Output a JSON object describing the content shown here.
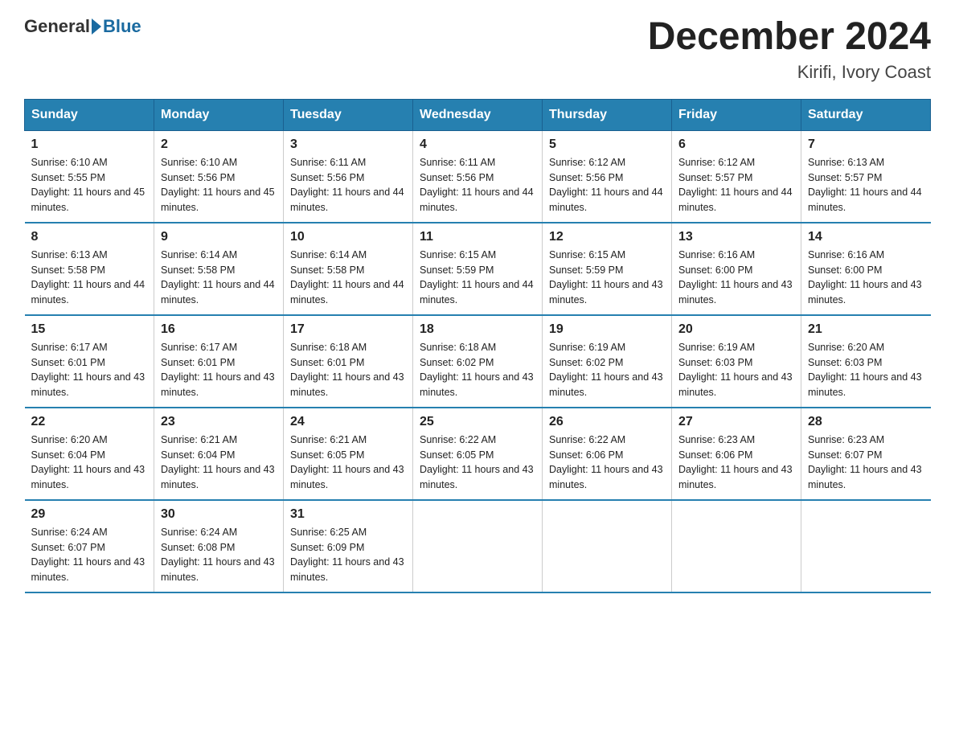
{
  "header": {
    "logo_general": "General",
    "logo_blue": "Blue",
    "month_title": "December 2024",
    "location": "Kirifi, Ivory Coast"
  },
  "weekdays": [
    "Sunday",
    "Monday",
    "Tuesday",
    "Wednesday",
    "Thursday",
    "Friday",
    "Saturday"
  ],
  "weeks": [
    [
      {
        "day": "1",
        "sunrise": "6:10 AM",
        "sunset": "5:55 PM",
        "daylight": "11 hours and 45 minutes."
      },
      {
        "day": "2",
        "sunrise": "6:10 AM",
        "sunset": "5:56 PM",
        "daylight": "11 hours and 45 minutes."
      },
      {
        "day": "3",
        "sunrise": "6:11 AM",
        "sunset": "5:56 PM",
        "daylight": "11 hours and 44 minutes."
      },
      {
        "day": "4",
        "sunrise": "6:11 AM",
        "sunset": "5:56 PM",
        "daylight": "11 hours and 44 minutes."
      },
      {
        "day": "5",
        "sunrise": "6:12 AM",
        "sunset": "5:56 PM",
        "daylight": "11 hours and 44 minutes."
      },
      {
        "day": "6",
        "sunrise": "6:12 AM",
        "sunset": "5:57 PM",
        "daylight": "11 hours and 44 minutes."
      },
      {
        "day": "7",
        "sunrise": "6:13 AM",
        "sunset": "5:57 PM",
        "daylight": "11 hours and 44 minutes."
      }
    ],
    [
      {
        "day": "8",
        "sunrise": "6:13 AM",
        "sunset": "5:58 PM",
        "daylight": "11 hours and 44 minutes."
      },
      {
        "day": "9",
        "sunrise": "6:14 AM",
        "sunset": "5:58 PM",
        "daylight": "11 hours and 44 minutes."
      },
      {
        "day": "10",
        "sunrise": "6:14 AM",
        "sunset": "5:58 PM",
        "daylight": "11 hours and 44 minutes."
      },
      {
        "day": "11",
        "sunrise": "6:15 AM",
        "sunset": "5:59 PM",
        "daylight": "11 hours and 44 minutes."
      },
      {
        "day": "12",
        "sunrise": "6:15 AM",
        "sunset": "5:59 PM",
        "daylight": "11 hours and 43 minutes."
      },
      {
        "day": "13",
        "sunrise": "6:16 AM",
        "sunset": "6:00 PM",
        "daylight": "11 hours and 43 minutes."
      },
      {
        "day": "14",
        "sunrise": "6:16 AM",
        "sunset": "6:00 PM",
        "daylight": "11 hours and 43 minutes."
      }
    ],
    [
      {
        "day": "15",
        "sunrise": "6:17 AM",
        "sunset": "6:01 PM",
        "daylight": "11 hours and 43 minutes."
      },
      {
        "day": "16",
        "sunrise": "6:17 AM",
        "sunset": "6:01 PM",
        "daylight": "11 hours and 43 minutes."
      },
      {
        "day": "17",
        "sunrise": "6:18 AM",
        "sunset": "6:01 PM",
        "daylight": "11 hours and 43 minutes."
      },
      {
        "day": "18",
        "sunrise": "6:18 AM",
        "sunset": "6:02 PM",
        "daylight": "11 hours and 43 minutes."
      },
      {
        "day": "19",
        "sunrise": "6:19 AM",
        "sunset": "6:02 PM",
        "daylight": "11 hours and 43 minutes."
      },
      {
        "day": "20",
        "sunrise": "6:19 AM",
        "sunset": "6:03 PM",
        "daylight": "11 hours and 43 minutes."
      },
      {
        "day": "21",
        "sunrise": "6:20 AM",
        "sunset": "6:03 PM",
        "daylight": "11 hours and 43 minutes."
      }
    ],
    [
      {
        "day": "22",
        "sunrise": "6:20 AM",
        "sunset": "6:04 PM",
        "daylight": "11 hours and 43 minutes."
      },
      {
        "day": "23",
        "sunrise": "6:21 AM",
        "sunset": "6:04 PM",
        "daylight": "11 hours and 43 minutes."
      },
      {
        "day": "24",
        "sunrise": "6:21 AM",
        "sunset": "6:05 PM",
        "daylight": "11 hours and 43 minutes."
      },
      {
        "day": "25",
        "sunrise": "6:22 AM",
        "sunset": "6:05 PM",
        "daylight": "11 hours and 43 minutes."
      },
      {
        "day": "26",
        "sunrise": "6:22 AM",
        "sunset": "6:06 PM",
        "daylight": "11 hours and 43 minutes."
      },
      {
        "day": "27",
        "sunrise": "6:23 AM",
        "sunset": "6:06 PM",
        "daylight": "11 hours and 43 minutes."
      },
      {
        "day": "28",
        "sunrise": "6:23 AM",
        "sunset": "6:07 PM",
        "daylight": "11 hours and 43 minutes."
      }
    ],
    [
      {
        "day": "29",
        "sunrise": "6:24 AM",
        "sunset": "6:07 PM",
        "daylight": "11 hours and 43 minutes."
      },
      {
        "day": "30",
        "sunrise": "6:24 AM",
        "sunset": "6:08 PM",
        "daylight": "11 hours and 43 minutes."
      },
      {
        "day": "31",
        "sunrise": "6:25 AM",
        "sunset": "6:09 PM",
        "daylight": "11 hours and 43 minutes."
      },
      null,
      null,
      null,
      null
    ]
  ]
}
